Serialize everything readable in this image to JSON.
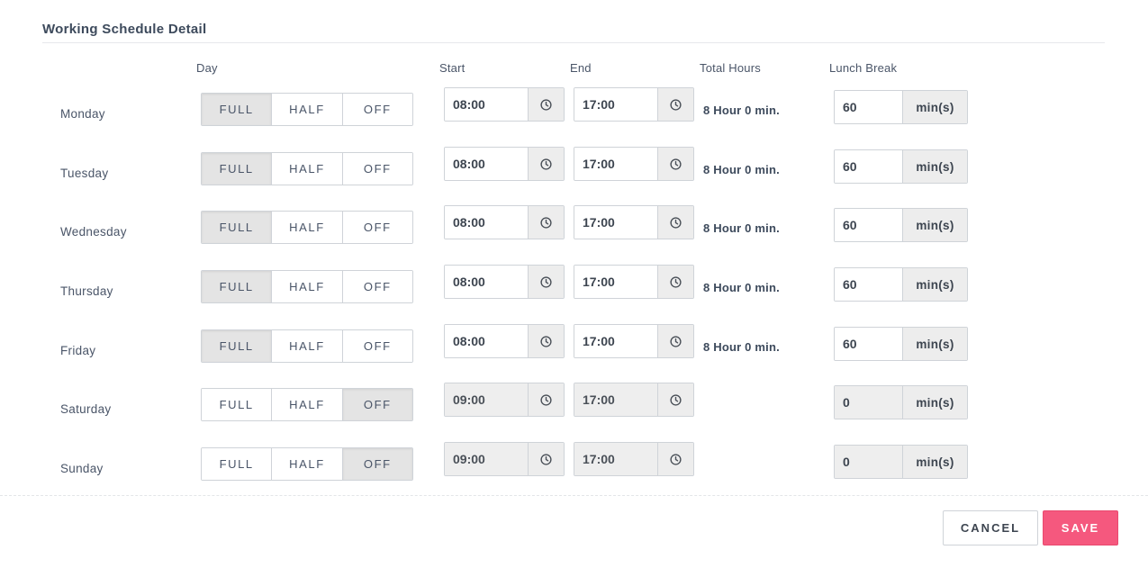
{
  "section": {
    "title": "Working Schedule Detail"
  },
  "columns": {
    "day": "Day",
    "start": "Start",
    "end": "End",
    "total": "Total Hours",
    "lunch": "Lunch Break"
  },
  "options": {
    "full": "FULL",
    "half": "HALF",
    "off": "OFF"
  },
  "icons": {
    "clock": "clock-icon"
  },
  "days": [
    {
      "name": "Monday",
      "mode": "full",
      "start": "08:00",
      "end": "17:00",
      "total": "8 Hour 0 min.",
      "lunch": "60",
      "unit": "min(s)",
      "disabled": false
    },
    {
      "name": "Tuesday",
      "mode": "full",
      "start": "08:00",
      "end": "17:00",
      "total": "8 Hour 0 min.",
      "lunch": "60",
      "unit": "min(s)",
      "disabled": false
    },
    {
      "name": "Wednesday",
      "mode": "full",
      "start": "08:00",
      "end": "17:00",
      "total": "8 Hour 0 min.",
      "lunch": "60",
      "unit": "min(s)",
      "disabled": false
    },
    {
      "name": "Thursday",
      "mode": "full",
      "start": "08:00",
      "end": "17:00",
      "total": "8 Hour 0 min.",
      "lunch": "60",
      "unit": "min(s)",
      "disabled": false
    },
    {
      "name": "Friday",
      "mode": "full",
      "start": "08:00",
      "end": "17:00",
      "total": "8 Hour 0 min.",
      "lunch": "60",
      "unit": "min(s)",
      "disabled": false
    },
    {
      "name": "Saturday",
      "mode": "off",
      "start": "09:00",
      "end": "17:00",
      "total": "",
      "lunch": "0",
      "unit": "min(s)",
      "disabled": true
    },
    {
      "name": "Sunday",
      "mode": "off",
      "start": "09:00",
      "end": "17:00",
      "total": "",
      "lunch": "0",
      "unit": "min(s)",
      "disabled": true
    }
  ],
  "footer": {
    "cancel": "CANCEL",
    "save": "SAVE"
  },
  "colors": {
    "accent": "#f5587e",
    "active_segment": "#e4e4e4",
    "disabled_field": "#eeeeee"
  }
}
